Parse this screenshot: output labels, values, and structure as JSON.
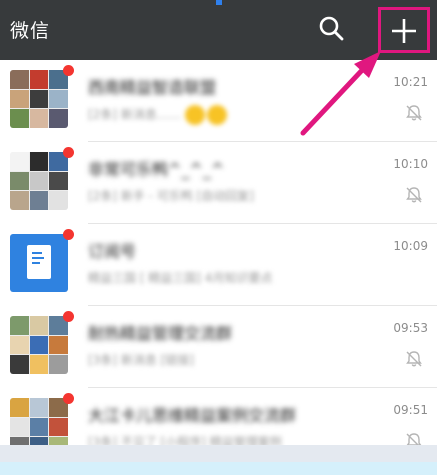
{
  "header": {
    "title": "微信",
    "search_icon": "search-icon",
    "add_icon": "plus-icon",
    "highlight_color": "#e0177f"
  },
  "chats": [
    {
      "name": "西南精益智造联盟",
      "preview": "[2条] 新消息……",
      "time": "10:21",
      "muted": true,
      "unread": true
    },
    {
      "name": "非常可乐鸭^_^_^",
      "preview": "[2条] 新手 - 可乐鸭 [自动回复]",
      "time": "10:10",
      "muted": true,
      "unread": true
    },
    {
      "name": "订阅号",
      "preview": "精益三国 [ 精益三国] 4月知识要点",
      "time": "10:09",
      "muted": false,
      "unread": true
    },
    {
      "name": "耐热精益管理交流群",
      "preview": "[3条] 新消息 [链接]",
      "time": "09:53",
      "muted": true,
      "unread": true
    },
    {
      "name": "大江卡儿思维精益案例交流群",
      "preview": "[3条] 不见了 [小程序] 精益管理案例",
      "time": "09:51",
      "muted": true,
      "unread": true
    }
  ]
}
